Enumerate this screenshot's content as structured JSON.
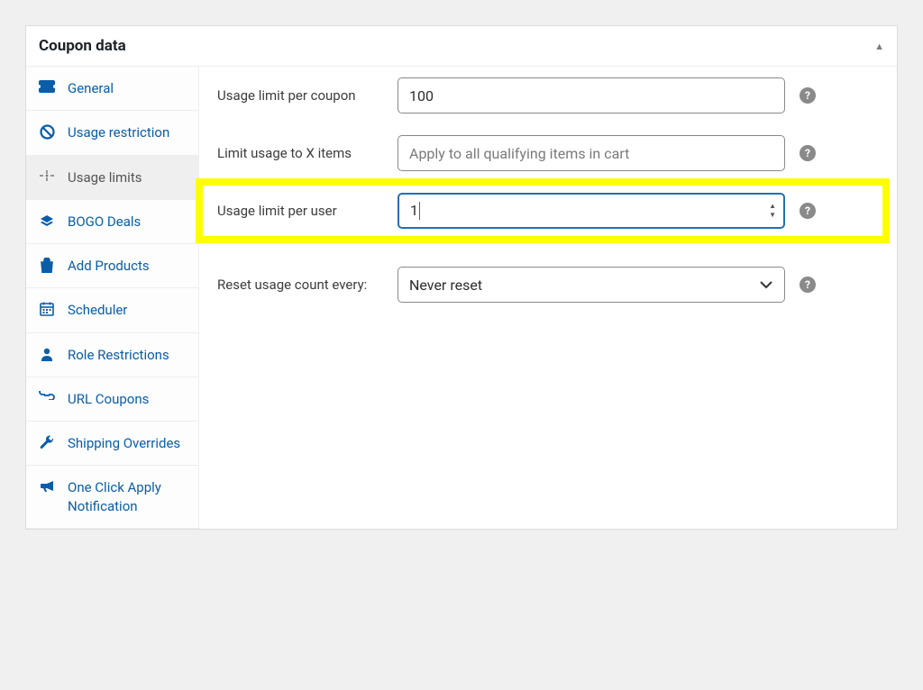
{
  "panel": {
    "title": "Coupon data"
  },
  "sidebar": {
    "items": [
      {
        "label": "General",
        "icon": "ticket"
      },
      {
        "label": "Usage restriction",
        "icon": "ban"
      },
      {
        "label": "Usage limits",
        "icon": "limits",
        "active": true
      },
      {
        "label": "BOGO Deals",
        "icon": "stack"
      },
      {
        "label": "Add Products",
        "icon": "bag"
      },
      {
        "label": "Scheduler",
        "icon": "calendar"
      },
      {
        "label": "Role Restrictions",
        "icon": "user"
      },
      {
        "label": "URL Coupons",
        "icon": "link"
      },
      {
        "label": "Shipping Overrides",
        "icon": "wrench"
      },
      {
        "label": "One Click Apply Notification",
        "icon": "megaphone"
      }
    ]
  },
  "form": {
    "usage_limit_per_coupon": {
      "label": "Usage limit per coupon",
      "value": "100"
    },
    "limit_usage_items": {
      "label": "Limit usage to X items",
      "placeholder": "Apply to all qualifying items in cart"
    },
    "usage_limit_per_user": {
      "label": "Usage limit per user",
      "value": "1"
    },
    "reset_usage": {
      "label": "Reset usage count every:",
      "value": "Never reset"
    }
  },
  "icons": {
    "help": "?"
  }
}
